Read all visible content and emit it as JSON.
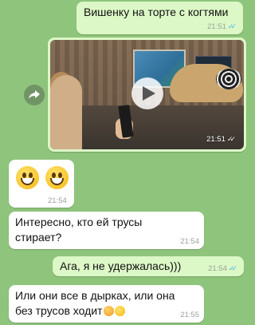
{
  "chat": {
    "messages": [
      {
        "direction": "outgoing",
        "type": "text",
        "text": "Вишенку на торте с когтями",
        "time": "21:51",
        "status": "read"
      },
      {
        "direction": "outgoing",
        "type": "video",
        "time": "21:51",
        "status": "read",
        "forward_icon": "forward-icon",
        "play_icon": "play-icon"
      },
      {
        "direction": "incoming",
        "type": "emoji",
        "emoji": [
          "grinning-face",
          "grinning-face"
        ],
        "time": "21:54"
      },
      {
        "direction": "incoming",
        "type": "text",
        "line1": "Интересно, кто ей трусы",
        "line2": "стирает?",
        "time": "21:54"
      },
      {
        "direction": "outgoing",
        "type": "text",
        "text": "Ага, я не удержалась)))",
        "time": "21:54",
        "status": "read"
      },
      {
        "direction": "incoming",
        "type": "text",
        "line1": "Или они все в дырках, или она",
        "line2": "без трусов ходит",
        "emoji": [
          "flushed-face",
          "hushed-face"
        ],
        "time": "21:55"
      }
    ]
  },
  "colors": {
    "wallpaper": "#8fc47c",
    "outgoing_bubble": "#dcf8c6",
    "incoming_bubble": "#ffffff",
    "read_ticks": "#4fb6ec"
  }
}
